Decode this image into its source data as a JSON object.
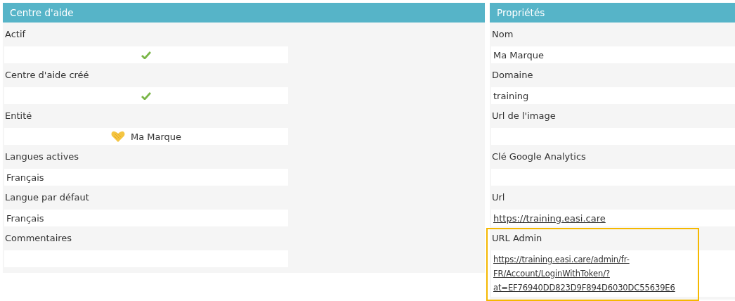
{
  "panels": [
    {
      "title": "Centre d'aide",
      "fields": [
        {
          "label": "Actif",
          "kind": "check",
          "checked": true,
          "highlighted": false
        },
        {
          "label": "Centre d'aide créé",
          "kind": "check",
          "checked": true,
          "highlighted": false
        },
        {
          "label": "Entité",
          "kind": "entity",
          "value": "Ma Marque",
          "highlighted": false
        },
        {
          "label": "Langues actives",
          "kind": "text",
          "value": "Français",
          "highlighted": false
        },
        {
          "label": "Langue par défaut",
          "kind": "text",
          "value": "Français",
          "highlighted": false
        },
        {
          "label": "Commentaires",
          "kind": "text",
          "highlighted": false
        }
      ]
    },
    {
      "title": "Propriétés",
      "fields": [
        {
          "label": "Nom",
          "kind": "text",
          "value": "Ma Marque",
          "highlighted": false
        },
        {
          "label": "Domaine",
          "kind": "text",
          "value": "training",
          "highlighted": false
        },
        {
          "label": "Url de l'image",
          "kind": "text",
          "highlighted": false
        },
        {
          "label": "Clé Google Analytics",
          "kind": "text",
          "highlighted": false
        },
        {
          "label": "Url",
          "kind": "link",
          "value": "https://training.easi.care",
          "highlighted": false
        },
        {
          "label": "URL Admin",
          "kind": "link",
          "value": "https://training.easi.care/admin/fr-FR/Account/LoginWithToken/?at=EF76940DD823D9F894D6030DC55639E6",
          "highlighted": true
        }
      ]
    }
  ]
}
